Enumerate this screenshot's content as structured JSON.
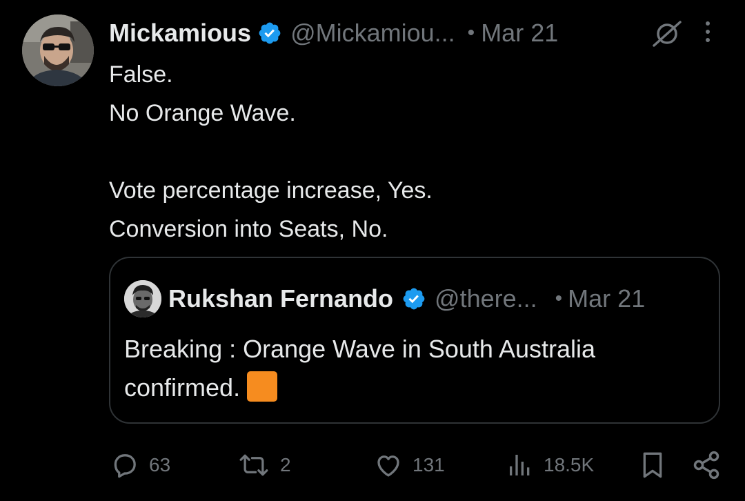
{
  "tweet": {
    "author_name": "Mickamious",
    "handle": "@Mickamiou...",
    "separator": "•",
    "date": "Mar 21",
    "body": [
      "False.",
      "No Orange Wave.",
      "",
      "Vote percentage increase, Yes.",
      "Conversion into Seats, No."
    ],
    "icons": {
      "verified": "verified-badge-icon",
      "grok": "grok-icon",
      "more": "more-options-icon"
    },
    "accent_color": "#1d9bf0"
  },
  "quote": {
    "author_name": "Rukshan Fernando",
    "handle": "@there...",
    "separator": "•",
    "date": "Mar 21",
    "text_line1": "Breaking : Orange Wave in South Australia",
    "text_line2": "confirmed.",
    "emoji": "orange-square-emoji",
    "emoji_color": "#f68c1f"
  },
  "actions": {
    "replies": "63",
    "reposts": "2",
    "likes": "131",
    "views": "18.5K"
  }
}
